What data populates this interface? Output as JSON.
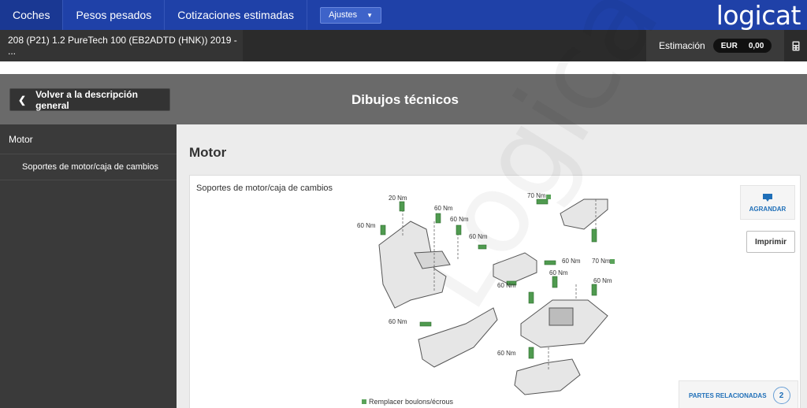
{
  "nav": {
    "tabs": [
      {
        "label": "Coches",
        "active": true
      },
      {
        "label": "Pesos pesados",
        "active": false
      },
      {
        "label": "Cotizaciones estimadas",
        "active": false
      }
    ],
    "settings_label": "Ajustes",
    "logo": "logicat"
  },
  "vehicle_bar": {
    "vehicle": "208 (P21) 1.2 PureTech 100 (EB2ADTD (HNK)) 2019 - ...",
    "estimate_label": "Estimación",
    "currency": "EUR",
    "amount": "0,00",
    "calculator_icon": "calculator-icon"
  },
  "title_bar": {
    "back_label": "Volver a la descripción general",
    "title": "Dibujos técnicos"
  },
  "sidebar": {
    "items": [
      {
        "label": "Motor"
      },
      {
        "label": "Soportes de motor/caja de cambios"
      }
    ]
  },
  "main": {
    "section_title": "Motor",
    "panel_title": "Soportes de motor/caja de cambios",
    "enlarge_label": "AGRANDAR",
    "print_label": "Imprimir",
    "related_label": "PARTES RELACIONADAS",
    "related_count": "2",
    "legend_label": "Remplacer boulons/écrous",
    "watermark": "Logicat",
    "torque_labels": [
      "20 Nm",
      "60 Nm",
      "60 Nm",
      "60 Nm",
      "60 Nm",
      "60 Nm",
      "70 Nm",
      "70 Nm",
      "60 Nm",
      "60 Nm",
      "60 Nm",
      "60 Nm",
      "60 Nm"
    ],
    "accent_color": "#1f41a8",
    "bolt_color": "#4f9a4f"
  }
}
